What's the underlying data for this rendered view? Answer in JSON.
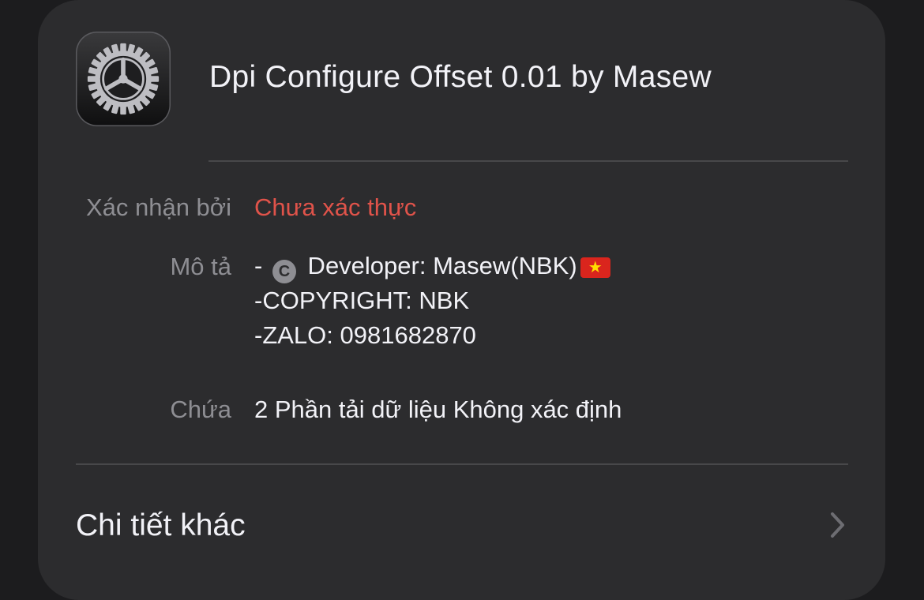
{
  "profile": {
    "title": "Dpi Configure Offset 0.01 by Masew",
    "icon": "settings-gear-icon"
  },
  "details": {
    "verified_label": "Xác nhận bởi",
    "verified_value": "Chưa xác thực",
    "verified_color": "#e0534a",
    "description_label": "Mô tả",
    "description_lines": {
      "line1_prefix": "- ",
      "line1_icon": "copyright-icon",
      "line1_icon_glyph": "C",
      "line1_text": " Developer: Masew(NBK)",
      "line1_flag": "vietnam-flag-icon",
      "line2": "-COPYRIGHT: NBK",
      "line3": "-ZALO: 0981682870"
    },
    "contains_label": "Chứa",
    "contains_value": "2 Phần tải dữ liệu Không xác định"
  },
  "more": {
    "label": "Chi tiết khác",
    "icon": "chevron-right-icon"
  }
}
